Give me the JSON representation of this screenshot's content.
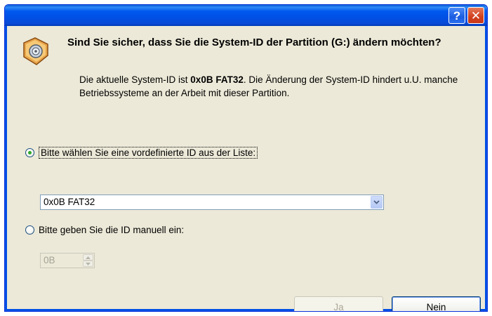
{
  "titlebar": {
    "help_label": "?",
    "close_label": "✕"
  },
  "dialog": {
    "question": "Sind Sie sicher, dass Sie die System-ID der Partition (G:) ändern möchten?",
    "info_prefix": "Die aktuelle System-ID ist ",
    "info_id": "0x0B FAT32",
    "info_suffix": ". Die Änderung der System-ID hindert u.U. manche Betriebssysteme an der Arbeit mit dieser Partition."
  },
  "options": {
    "predefined": {
      "label": "Bitte wählen Sie eine vordefinierte ID aus der Liste:",
      "selected": true
    },
    "manual": {
      "label": "Bitte geben Sie die ID manuell ein:",
      "selected": false
    }
  },
  "select": {
    "value": "0x0B FAT32"
  },
  "spinner": {
    "value": "0B"
  },
  "buttons": {
    "yes": "Ja",
    "no": "Nein"
  },
  "colors": {
    "title_bar": "#0058ee",
    "dialog_bg": "#ece9d8",
    "close_button": "#d1401c",
    "radio_dot": "#2fa82a"
  },
  "icons": {
    "dialog_icon": "warning-disk-icon"
  }
}
